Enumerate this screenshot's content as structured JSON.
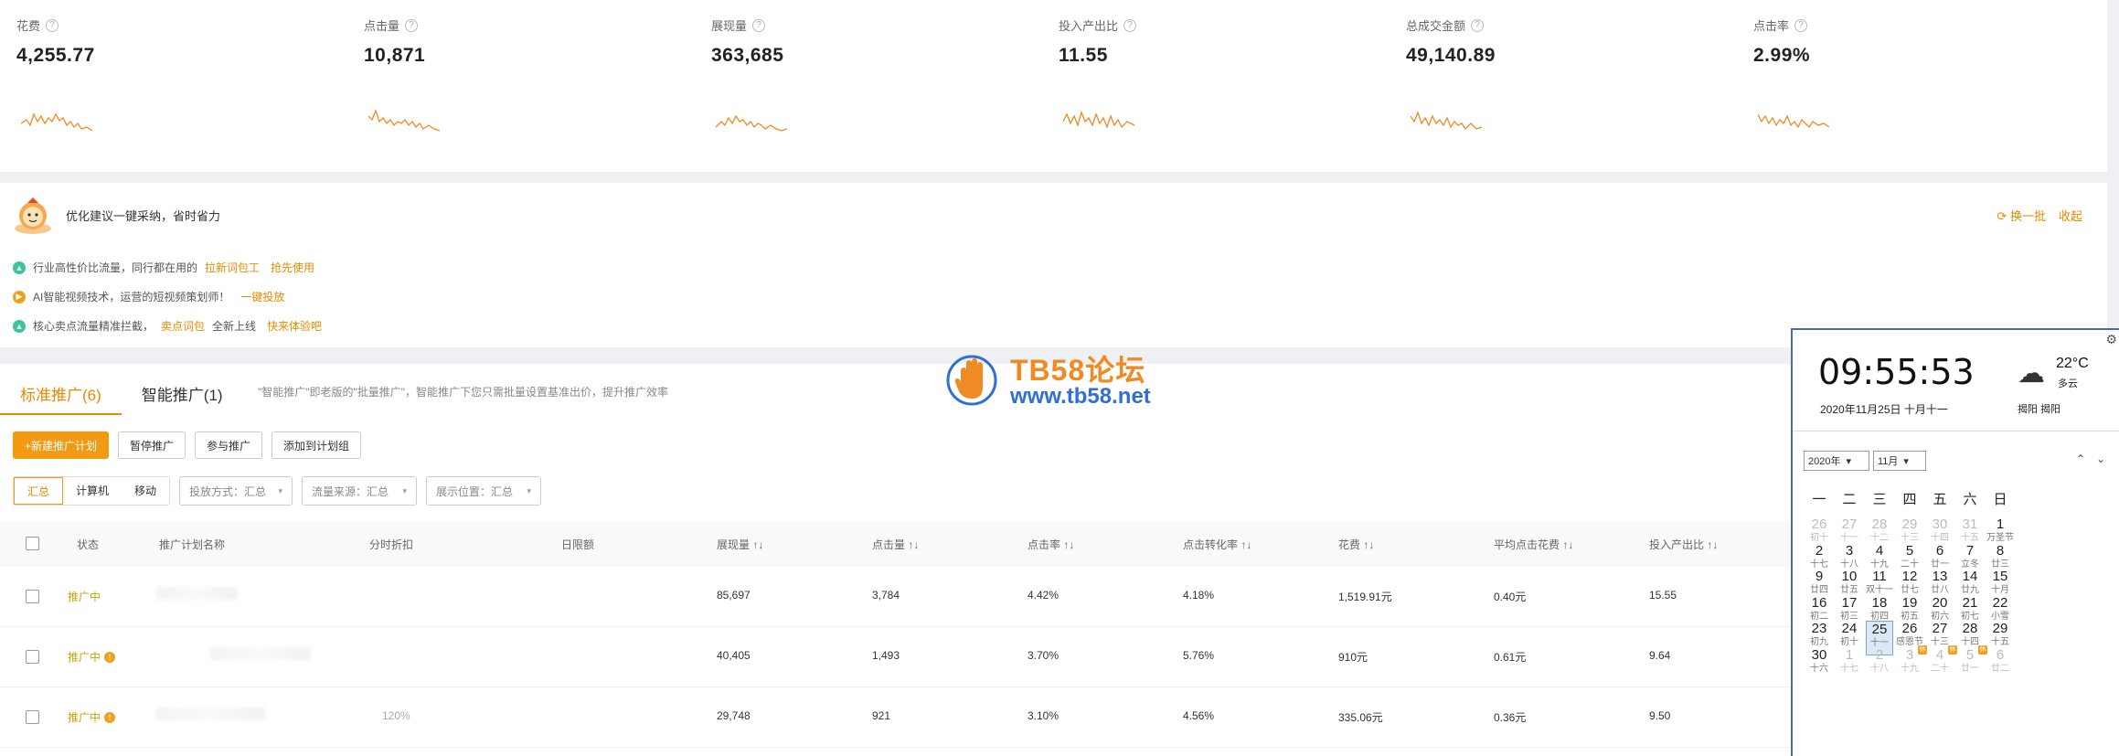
{
  "metrics": [
    {
      "label": "花费",
      "value": "4,255.77"
    },
    {
      "label": "点击量",
      "value": "10,871"
    },
    {
      "label": "展现量",
      "value": "363,685"
    },
    {
      "label": "投入产出比",
      "value": "11.55"
    },
    {
      "label": "总成交金额",
      "value": "49,140.89"
    },
    {
      "label": "点击率",
      "value": "2.99%"
    }
  ],
  "suggest": {
    "title": "优化建议一键采纳，省时省力",
    "refresh": "换一批",
    "collapse": "收起",
    "tips": [
      {
        "pre": "行业高性价比流量，同行都在用的",
        "hl": "拉新词包工",
        "link": "抢先使用"
      },
      {
        "pre": "AI智能视频技术，运营的短视频策划师！",
        "hl": "",
        "link": "一键投放"
      },
      {
        "pre": "核心卖点流量精准拦截，",
        "hl": "卖点词包",
        "post": "全新上线",
        "link": "快来体验吧"
      }
    ]
  },
  "tabs": [
    {
      "label": "标准推广(6)"
    },
    {
      "label": "智能推广(1)"
    }
  ],
  "tab_hint": "\"智能推广\"即老版的\"批量推广\"，智能推广下您只需批量设置基准出价，提升推广效率",
  "buttons": {
    "new_plan": "+新建推广计划",
    "pause": "暂停推广",
    "join": "参与推广",
    "add_group": "添加到计划组"
  },
  "filters": {
    "segments": [
      "汇总",
      "计算机",
      "移动"
    ],
    "invest": "投放方式：汇总",
    "source": "流量来源：汇总",
    "position": "展示位置：汇总"
  },
  "table": {
    "headers": [
      "状态",
      "推广计划名称",
      "分时折扣",
      "日限额",
      "展现量",
      "点击量",
      "点击率",
      "点击转化率",
      "花费",
      "平均点击花费",
      "投入产出比"
    ],
    "rows": [
      {
        "status": "推广中",
        "discount": "",
        "impr": "85,697",
        "clicks": "3,784",
        "ctr": "4.42%",
        "cvr": "4.18%",
        "cost": "1,519.91元",
        "cpc": "0.40元",
        "roi": "15.55"
      },
      {
        "status": "推广中",
        "discount": "",
        "impr": "40,405",
        "clicks": "1,493",
        "ctr": "3.70%",
        "cvr": "5.76%",
        "cost": "910元",
        "cpc": "0.61元",
        "roi": "9.64"
      },
      {
        "status": "推广中",
        "discount": "120%",
        "impr": "29,748",
        "clicks": "921",
        "ctr": "3.10%",
        "cvr": "4.56%",
        "cost": "335.06元",
        "cpc": "0.36元",
        "roi": "9.50"
      }
    ]
  },
  "watermark": {
    "title": "TB58论坛",
    "url": "www.tb58.net"
  },
  "calendar": {
    "time": "09:55:53",
    "date": "2020年11月25日 十月十一",
    "temp": "22°C",
    "condition": "多云",
    "location": "揭阳 揭阳",
    "year_select": "2020年",
    "month_select": "11月",
    "weekdays": [
      "一",
      "二",
      "三",
      "四",
      "五",
      "六",
      "日"
    ],
    "days": [
      {
        "n": "26",
        "l": "初十",
        "out": true
      },
      {
        "n": "27",
        "l": "十一",
        "out": true
      },
      {
        "n": "28",
        "l": "十二",
        "out": true
      },
      {
        "n": "29",
        "l": "十三",
        "out": true
      },
      {
        "n": "30",
        "l": "十四",
        "out": true
      },
      {
        "n": "31",
        "l": "十五",
        "out": true
      },
      {
        "n": "1",
        "l": "万圣节"
      },
      {
        "n": "2",
        "l": "十七"
      },
      {
        "n": "3",
        "l": "十八"
      },
      {
        "n": "4",
        "l": "十九"
      },
      {
        "n": "5",
        "l": "二十"
      },
      {
        "n": "6",
        "l": "廿一"
      },
      {
        "n": "7",
        "l": "立冬"
      },
      {
        "n": "8",
        "l": "廿三"
      },
      {
        "n": "9",
        "l": "廿四"
      },
      {
        "n": "10",
        "l": "廿五"
      },
      {
        "n": "11",
        "l": "双十一"
      },
      {
        "n": "12",
        "l": "廿七"
      },
      {
        "n": "13",
        "l": "廿八"
      },
      {
        "n": "14",
        "l": "廿九"
      },
      {
        "n": "15",
        "l": "十月"
      },
      {
        "n": "16",
        "l": "初二"
      },
      {
        "n": "17",
        "l": "初三"
      },
      {
        "n": "18",
        "l": "初四"
      },
      {
        "n": "19",
        "l": "初五"
      },
      {
        "n": "20",
        "l": "初六"
      },
      {
        "n": "21",
        "l": "初七"
      },
      {
        "n": "22",
        "l": "小雪"
      },
      {
        "n": "23",
        "l": "初九"
      },
      {
        "n": "24",
        "l": "初十"
      },
      {
        "n": "25",
        "l": "十一",
        "today": true
      },
      {
        "n": "26",
        "l": "感恩节"
      },
      {
        "n": "27",
        "l": "十三"
      },
      {
        "n": "28",
        "l": "十四"
      },
      {
        "n": "29",
        "l": "十五"
      },
      {
        "n": "30",
        "l": "十六"
      },
      {
        "n": "1",
        "l": "十七",
        "out": true
      },
      {
        "n": "2",
        "l": "十八",
        "out": true
      },
      {
        "n": "3",
        "l": "十九",
        "out": true,
        "badge": "休"
      },
      {
        "n": "4",
        "l": "二十",
        "out": true,
        "badge": "休"
      },
      {
        "n": "5",
        "l": "廿一",
        "out": true,
        "badge": "休"
      },
      {
        "n": "6",
        "l": "廿二",
        "out": true
      }
    ]
  }
}
